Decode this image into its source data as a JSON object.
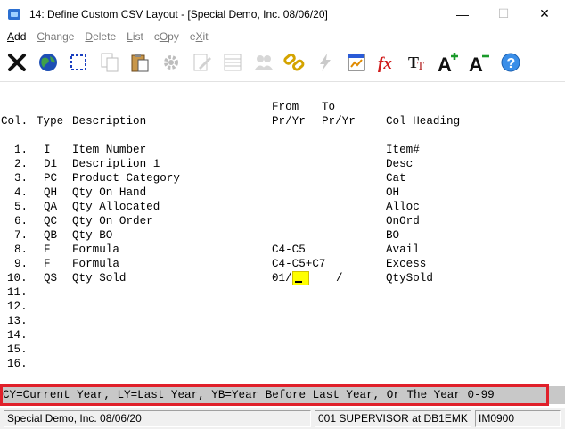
{
  "window": {
    "title": "14: Define Custom CSV Layout - [Special Demo, Inc. 08/06/20]",
    "minimize": "—",
    "maximize": "☐",
    "close": "✕"
  },
  "menu": [
    {
      "label": "Add",
      "active": true
    },
    {
      "label": "Change",
      "active": false
    },
    {
      "label": "Delete",
      "active": false
    },
    {
      "label": "List",
      "active": false
    },
    {
      "label": "cOpy",
      "active": false
    },
    {
      "label": "eXit",
      "active": false
    }
  ],
  "toolbar": [
    {
      "name": "close-x-icon",
      "enabled": true
    },
    {
      "name": "globe-icon",
      "enabled": true
    },
    {
      "name": "select-area-icon",
      "enabled": true
    },
    {
      "name": "copy-pages-icon",
      "enabled": false
    },
    {
      "name": "paste-clipboard-icon",
      "enabled": true
    },
    {
      "name": "gear-icon",
      "enabled": false
    },
    {
      "name": "edit-note-icon",
      "enabled": false
    },
    {
      "name": "grid-list-icon",
      "enabled": false
    },
    {
      "name": "users-icon",
      "enabled": false
    },
    {
      "name": "chain-link-icon",
      "enabled": true
    },
    {
      "name": "lightning-icon",
      "enabled": false
    },
    {
      "name": "calculator-chart-icon",
      "enabled": true
    },
    {
      "name": "function-fx-icon",
      "enabled": true
    },
    {
      "name": "font-tt-icon",
      "enabled": true
    },
    {
      "name": "font-increase-icon",
      "enabled": true
    },
    {
      "name": "font-decrease-icon",
      "enabled": true
    },
    {
      "name": "help-icon",
      "enabled": true
    }
  ],
  "headers": {
    "from_top": "From",
    "to_top": "To",
    "col": "Col.",
    "type": "Type",
    "description": "Description",
    "from": "Pr/Yr",
    "to": "Pr/Yr",
    "heading": "Col Heading"
  },
  "rows": [
    {
      "num": "1.",
      "type": "I",
      "desc": "Item Number",
      "from": "",
      "to": "",
      "heading": "Item#"
    },
    {
      "num": "2.",
      "type": "D1",
      "desc": "Description 1",
      "from": "",
      "to": "",
      "heading": "Desc"
    },
    {
      "num": "3.",
      "type": "PC",
      "desc": "Product Category",
      "from": "",
      "to": "",
      "heading": "Cat"
    },
    {
      "num": "4.",
      "type": "QH",
      "desc": "Qty On Hand",
      "from": "",
      "to": "",
      "heading": "OH"
    },
    {
      "num": "5.",
      "type": "QA",
      "desc": "Qty Allocated",
      "from": "",
      "to": "",
      "heading": "Alloc"
    },
    {
      "num": "6.",
      "type": "QC",
      "desc": "Qty On Order",
      "from": "",
      "to": "",
      "heading": "OnOrd"
    },
    {
      "num": "7.",
      "type": "QB",
      "desc": "Qty BO",
      "from": "",
      "to": "",
      "heading": "BO"
    },
    {
      "num": "8.",
      "type": "F",
      "desc": "Formula",
      "from": "C4-C5",
      "to": "",
      "heading": "Avail"
    },
    {
      "num": "9.",
      "type": "F",
      "desc": "Formula",
      "from": "C4-C5+C7",
      "to": "",
      "heading": "Excess"
    },
    {
      "num": "10.",
      "type": "QS",
      "desc": "Qty Sold",
      "from": "01/",
      "to": "/",
      "heading": "QtySold"
    },
    {
      "num": "11.",
      "type": "",
      "desc": "",
      "from": "",
      "to": "",
      "heading": ""
    },
    {
      "num": "12.",
      "type": "",
      "desc": "",
      "from": "",
      "to": "",
      "heading": ""
    },
    {
      "num": "13.",
      "type": "",
      "desc": "",
      "from": "",
      "to": "",
      "heading": ""
    },
    {
      "num": "14.",
      "type": "",
      "desc": "",
      "from": "",
      "to": "",
      "heading": ""
    },
    {
      "num": "15.",
      "type": "",
      "desc": "",
      "from": "",
      "to": "",
      "heading": ""
    },
    {
      "num": "16.",
      "type": "",
      "desc": "",
      "from": "",
      "to": "",
      "heading": ""
    }
  ],
  "hint": "CY=Current Year, LY=Last Year, YB=Year Before Last Year, Or The Year 0-99",
  "status": {
    "company": "Special Demo, Inc. 08/06/20",
    "user": "001 SUPERVISOR at DB1EMK",
    "program": "IM0900"
  }
}
